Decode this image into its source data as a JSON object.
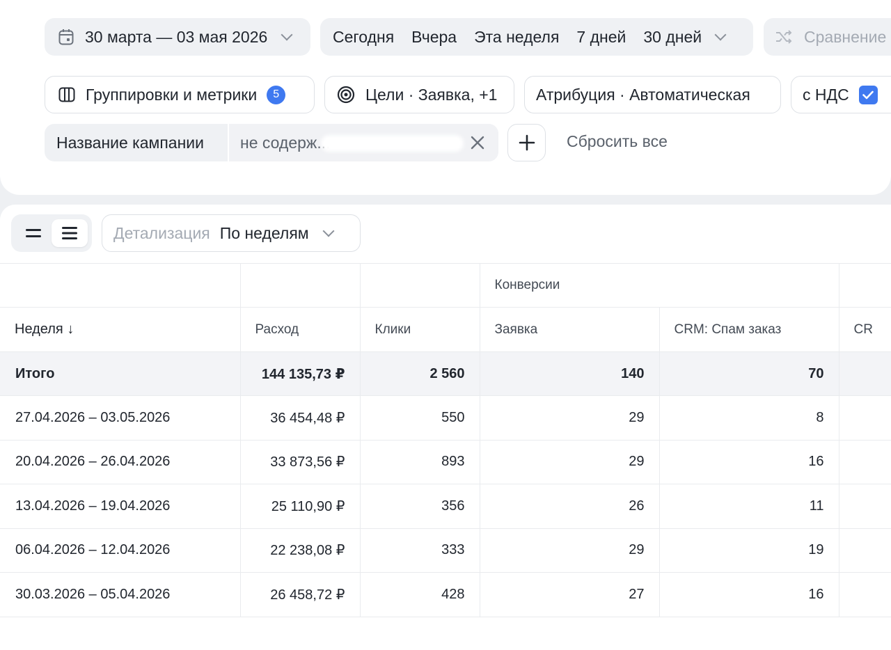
{
  "filters": {
    "date_range": "30 марта — 03 мая 2026",
    "periods": [
      "Сегодня",
      "Вчера",
      "Эта неделя",
      "7 дней",
      "30 дней"
    ],
    "compare_label": "Сравнение",
    "groupings_label": "Группировки и метрики",
    "groupings_count": "5",
    "goals_label": "Цели · Заявка, +1",
    "attribution_label": "Атрибуция · Автоматическая",
    "vat_label": "с НДС",
    "vat_checked": true,
    "campaign_filter": {
      "field": "Название кампании",
      "condition": "не содерж..."
    },
    "reset_label": "Сбросить все"
  },
  "toolbar": {
    "detail_label": "Детализация",
    "detail_value": "По неделям"
  },
  "table": {
    "group_header": "Конверсии",
    "columns": [
      "Неделя ↓",
      "Расход",
      "Клики",
      "Заявка",
      "CRM: Спам заказ",
      "CR"
    ],
    "total": [
      "Итого",
      "144 135,73 ₽",
      "2 560",
      "140",
      "70",
      ""
    ],
    "rows": [
      [
        "27.04.2026 – 03.05.2026",
        "36 454,48 ₽",
        "550",
        "29",
        "8",
        ""
      ],
      [
        "20.04.2026 – 26.04.2026",
        "33 873,56 ₽",
        "893",
        "29",
        "16",
        ""
      ],
      [
        "13.04.2026 – 19.04.2026",
        "25 110,90 ₽",
        "356",
        "26",
        "11",
        ""
      ],
      [
        "06.04.2026 – 12.04.2026",
        "22 238,08 ₽",
        "333",
        "29",
        "19",
        ""
      ],
      [
        "30.03.2026 – 05.04.2026",
        "26 458,72 ₽",
        "428",
        "27",
        "16",
        ""
      ]
    ]
  },
  "colors": {
    "accent": "#3f79f0",
    "text": "#21262e",
    "muted": "#a4aab3",
    "panel_bg": "#eef0f3",
    "total_row_bg": "#f3f4f7"
  }
}
